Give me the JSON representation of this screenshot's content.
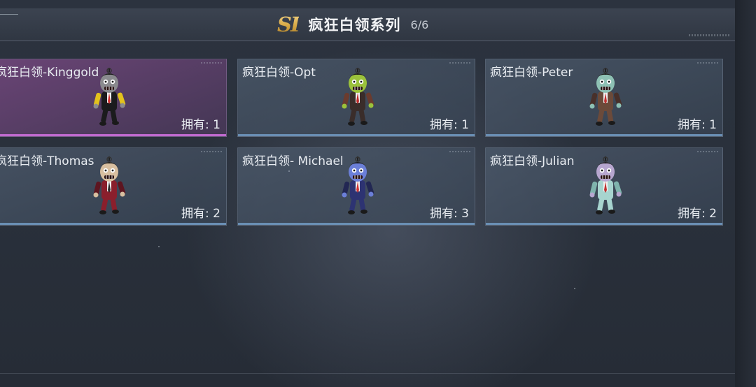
{
  "header": {
    "logo": "SI",
    "title": "疯狂白领系列",
    "progress": "6/6"
  },
  "cards": [
    {
      "name": "疯狂白领-Kinggold",
      "owned": "拥有: 1",
      "rarity": "purple",
      "head": "#8a8a8e",
      "suit": "#1b1b1d",
      "accent": "#e3c21c",
      "tie": "#d43030"
    },
    {
      "name": "疯狂白领-Opt",
      "owned": "拥有: 1",
      "rarity": "blue",
      "head": "#9bc23b",
      "suit": "#3a2d2a",
      "accent": "#6a3b2e",
      "tie": "#c02828"
    },
    {
      "name": "疯狂白领-Peter",
      "owned": "拥有: 1",
      "rarity": "blue",
      "head": "#8ec1b4",
      "suit": "#6b4a3a",
      "accent": "#48302a",
      "tie": "#c23232"
    },
    {
      "name": "疯狂白领-Thomas",
      "owned": "拥有: 2",
      "rarity": "blue",
      "head": "#d8bfa0",
      "suit": "#8a1f2c",
      "accent": "#5d1520",
      "tie": "#2a2a2a"
    },
    {
      "name": "疯狂白领- Michael",
      "owned": "拥有: 3",
      "rarity": "blue",
      "head": "#6b7fd8",
      "suit": "#2d3372",
      "accent": "#222753",
      "tie": "#d03232"
    },
    {
      "name": "疯狂白领-Julian",
      "owned": "拥有: 2",
      "rarity": "blue",
      "head": "#b7a6cf",
      "suit": "#a7d4cf",
      "accent": "#7fb3ad",
      "tie": "#c03030"
    }
  ]
}
